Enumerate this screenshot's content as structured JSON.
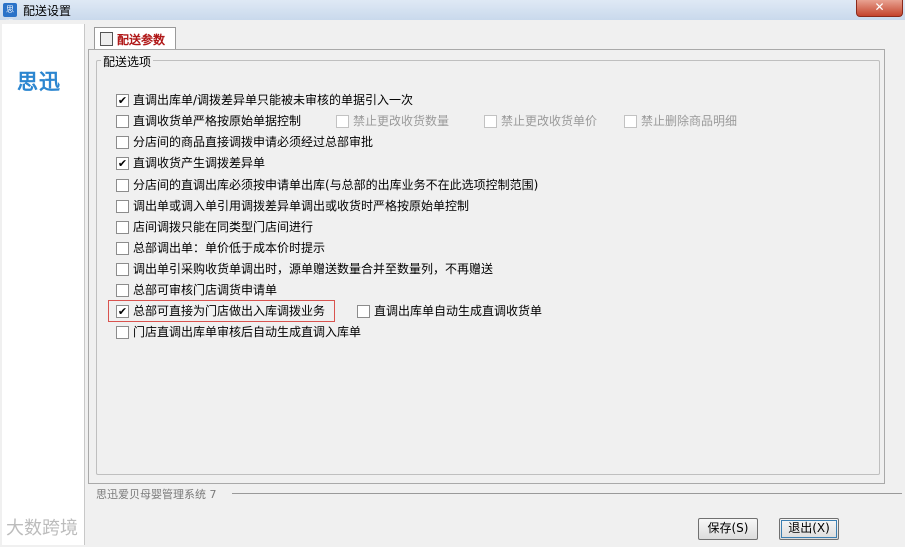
{
  "window": {
    "title": "配送设置",
    "close_label": "✕"
  },
  "app_icon_text": "思迅",
  "logo": "思迅",
  "tab": {
    "label": "配送参数"
  },
  "group_label": "配送选项",
  "options": {
    "o1": {
      "label": "直调出库单/调拨差异单只能被未审核的单据引入一次",
      "checked": "✔"
    },
    "o2": {
      "label": "直调收货单严格按原始单据控制",
      "checked": ""
    },
    "o2a": {
      "label": "禁止更改收货数量",
      "checked": ""
    },
    "o2b": {
      "label": "禁止更改收货单价",
      "checked": ""
    },
    "o2c": {
      "label": "禁止删除商品明细",
      "checked": ""
    },
    "o3": {
      "label": "分店间的商品直接调拨申请必须经过总部审批",
      "checked": ""
    },
    "o4": {
      "label": "直调收货产生调拨差异单",
      "checked": "✔"
    },
    "o5": {
      "label": "分店间的直调出库必须按申请单出库(与总部的出库业务不在此选项控制范围)",
      "checked": ""
    },
    "o6": {
      "label": "调出单或调入单引用调拨差异单调出或收货时严格按原始单控制",
      "checked": ""
    },
    "o7": {
      "label": "店间调拨只能在同类型门店间进行",
      "checked": ""
    },
    "o8": {
      "label": "总部调出单：单价低于成本价时提示",
      "checked": ""
    },
    "o9": {
      "label": "调出单引采购收货单调出时，源单赠送数量合并至数量列，不再赠送",
      "checked": ""
    },
    "o10": {
      "label": "总部可审核门店调货申请单",
      "checked": ""
    },
    "o11": {
      "label": "总部可直接为门店做出入库调拨业务",
      "checked": "✔"
    },
    "o11b": {
      "label": "直调出库单自动生成直调收货单",
      "checked": ""
    },
    "o12": {
      "label": "门店直调出库单审核后自动生成直调入库单",
      "checked": ""
    }
  },
  "footer": {
    "text": "思迅爱贝母婴管理系统 7"
  },
  "buttons": {
    "save": "保存(S)",
    "exit": "退出(X)"
  },
  "watermark": "大数跨境"
}
